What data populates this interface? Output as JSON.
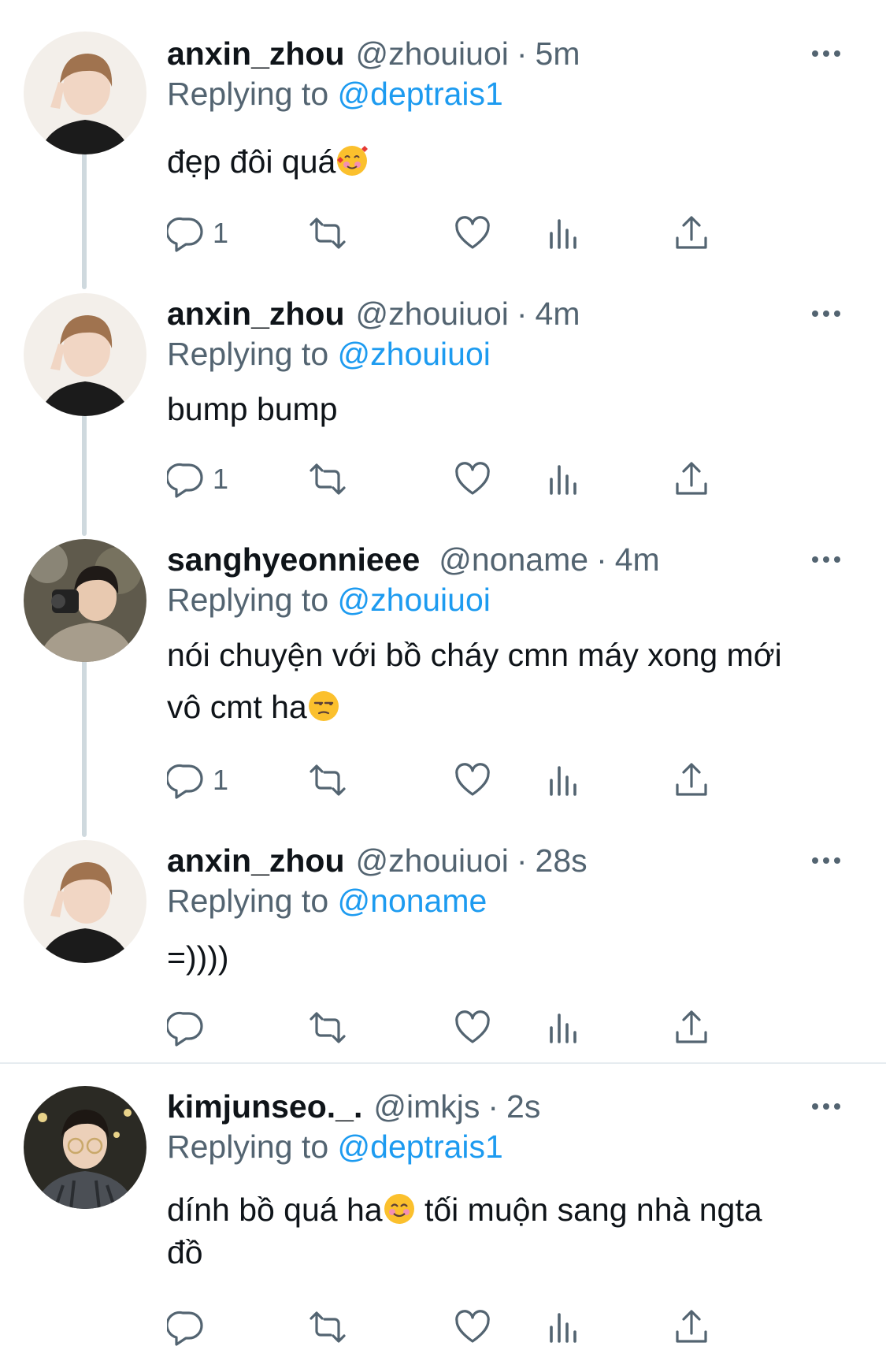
{
  "replies": [
    {
      "name": "anxin_zhou",
      "handle": "@zhouiuoi",
      "time": "5m",
      "replying_prefix": "Replying to",
      "replying_to": "@deptrais1",
      "text": "đẹp đôi quá",
      "emoji": "smiling-face-with-hearts",
      "reply_count": "1"
    },
    {
      "name": "anxin_zhou",
      "handle": "@zhouiuoi",
      "time": "4m",
      "replying_prefix": "Replying to",
      "replying_to": "@zhouiuoi",
      "text": "bump bump",
      "reply_count": "1"
    },
    {
      "name": "sanghyeonnieee",
      "handle": "@noname",
      "time": "4m",
      "replying_prefix": "Replying to",
      "replying_to": "@zhouiuoi",
      "text_line1": "nói chuyện với bồ cháy cmn máy xong mới",
      "text_line2": "vô cmt ha",
      "emoji": "unamused-face",
      "reply_count": "1"
    },
    {
      "name": "anxin_zhou",
      "handle": "@zhouiuoi",
      "time": "28s",
      "replying_prefix": "Replying to",
      "replying_to": "@noname",
      "text": "=))))",
      "reply_count": ""
    },
    {
      "name": "kimjunseo._.",
      "handle": "@imkjs",
      "time": "2s",
      "replying_prefix": "Replying to",
      "replying_to": "@deptrais1",
      "text_part1": "dính bồ quá ha",
      "emoji": "smiling-face-with-smiling-eyes",
      "text_part2": " tối muộn sang nhà ngta",
      "text_line2": "đồ",
      "reply_count": ""
    }
  ],
  "colors": {
    "text": "#0f1419",
    "secondary": "#536471",
    "mention": "#1d9bf0",
    "thread_line": "#cfd9de"
  },
  "icons": [
    "reply-icon",
    "retweet-icon",
    "like-icon",
    "views-icon",
    "share-icon",
    "more-icon"
  ]
}
